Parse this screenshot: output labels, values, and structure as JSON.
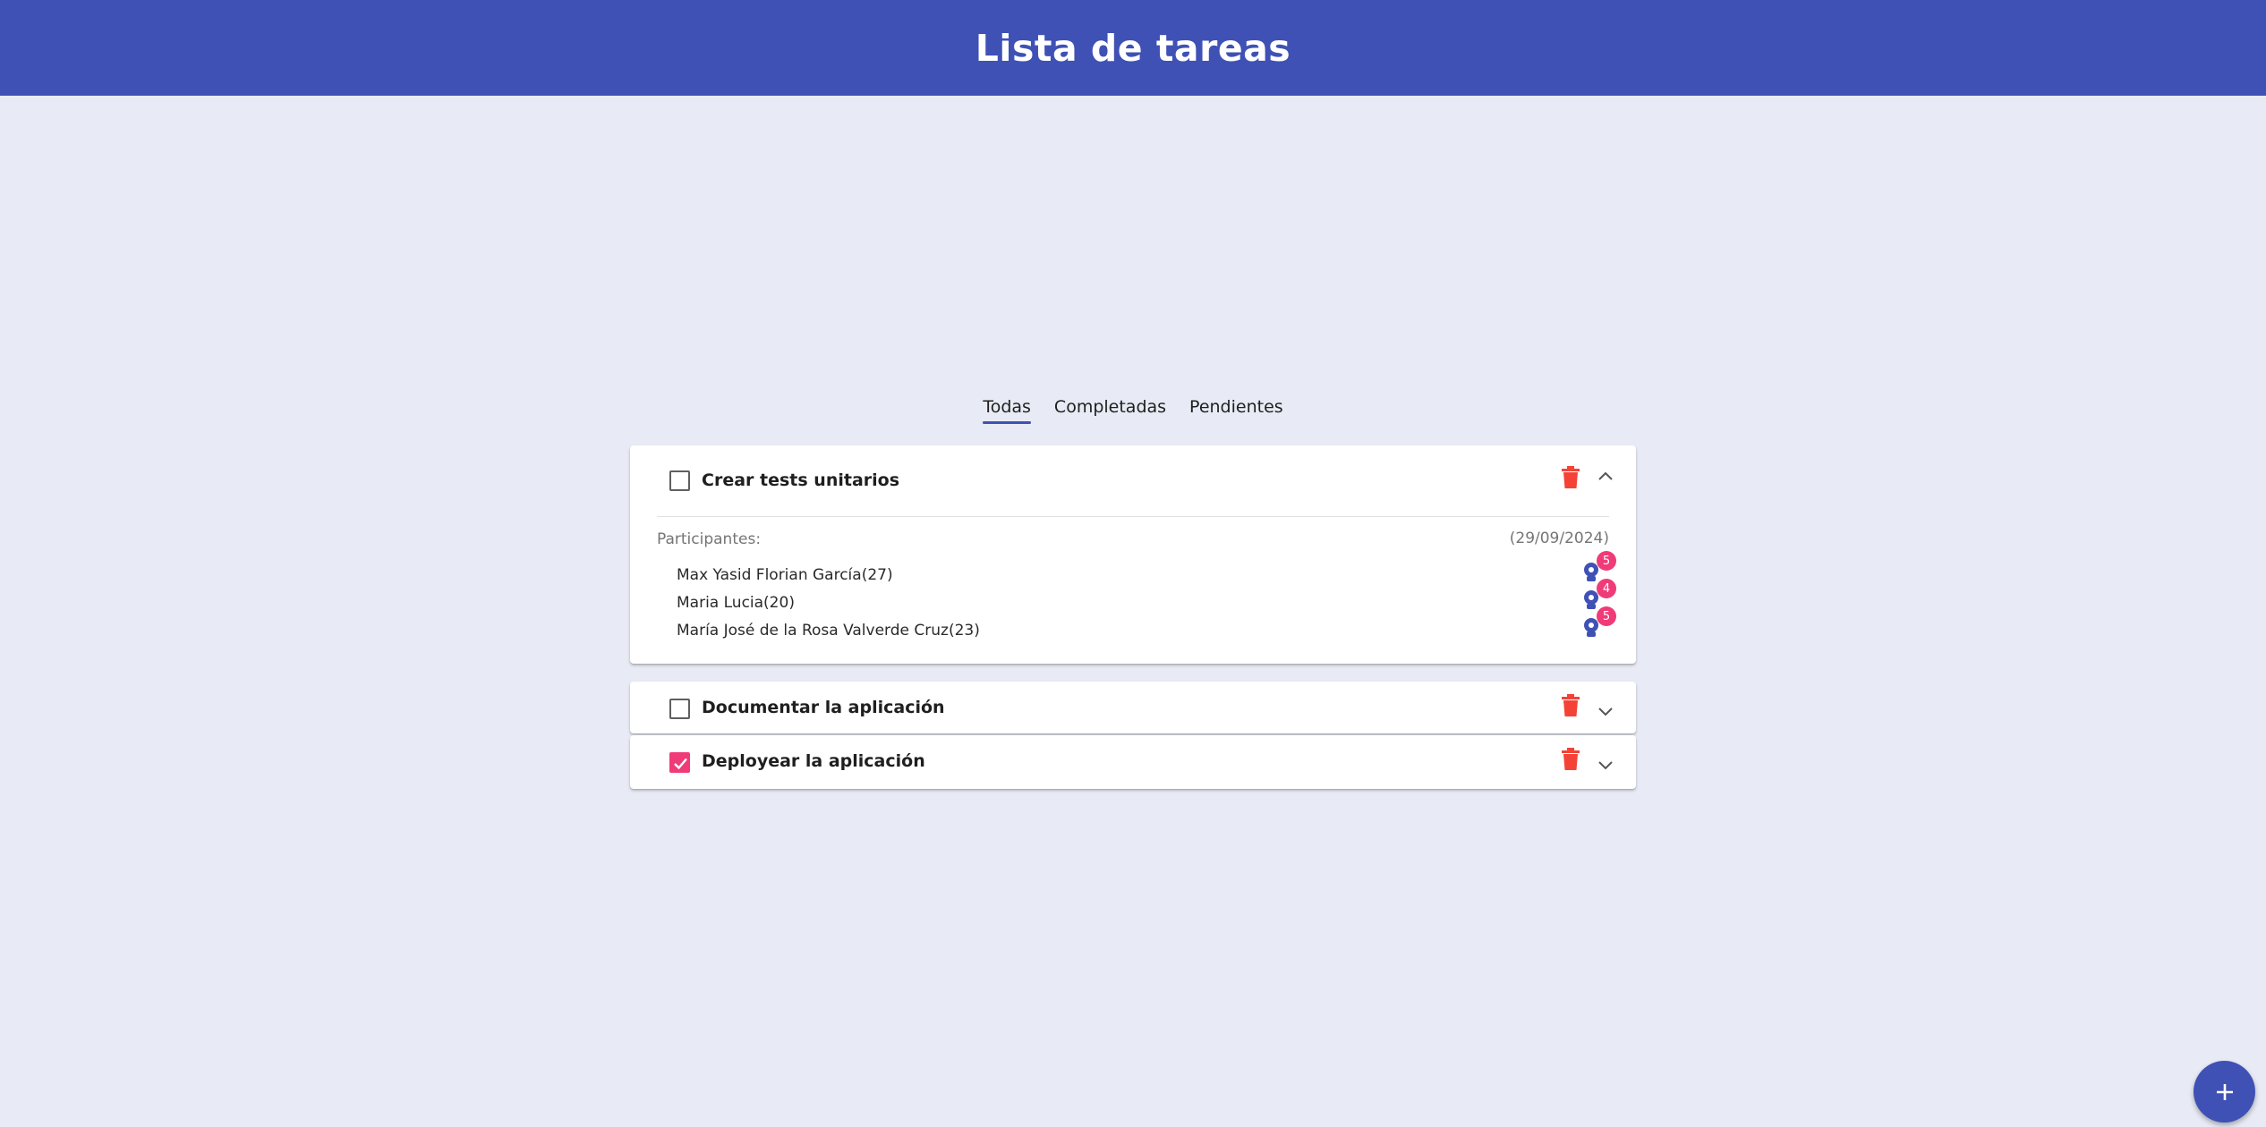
{
  "app": {
    "title": "Lista de tareas"
  },
  "filters": {
    "tabs": [
      {
        "label": "Todas",
        "active": true
      },
      {
        "label": "Completadas",
        "active": false
      },
      {
        "label": "Pendientes",
        "active": false
      }
    ]
  },
  "tasks": [
    {
      "title": "Crear tests unitarios",
      "completed": false,
      "expanded": true,
      "participants_label": "Participantes:",
      "due_date": "(29/09/2024)",
      "participants": [
        {
          "name": "Max Yasid Florian García(27)",
          "skills_count": "5",
          "icon": "settings-person-icon"
        },
        {
          "name": "Maria Lucia(20)",
          "skills_count": "4",
          "icon": "settings-person-icon"
        },
        {
          "name": "María José de la Rosa Valverde Cruz(23)",
          "skills_count": "5",
          "icon": "settings-person-icon"
        }
      ]
    },
    {
      "title": "Documentar la aplicación",
      "completed": false,
      "expanded": false
    },
    {
      "title": "Deployear la aplicación",
      "completed": true,
      "expanded": false
    }
  ],
  "actions": {
    "add_icon": "plus-icon",
    "delete_icon": "trash-icon"
  },
  "colors": {
    "primary": "#3f51b5",
    "accent": "#ef3b78",
    "delete": "#f44336",
    "background": "#e8ebf5"
  }
}
